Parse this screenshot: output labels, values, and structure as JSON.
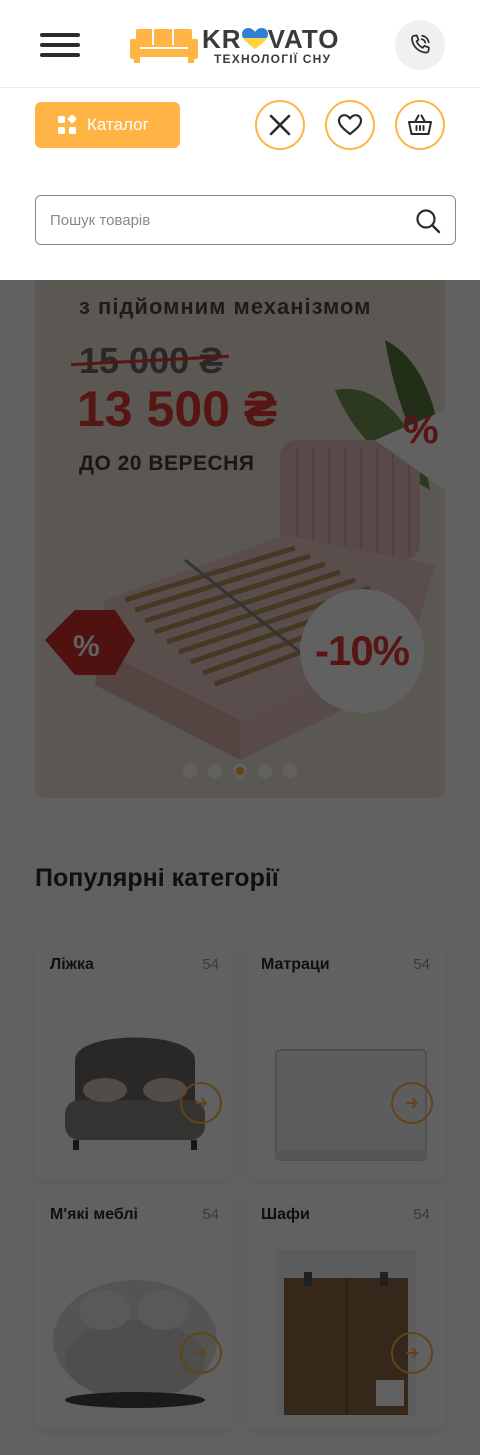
{
  "header": {
    "logo_brand_left": "KR",
    "logo_brand_right": "VATO",
    "logo_tagline": "ТЕХНОЛОГІЇ СНУ"
  },
  "toolbar": {
    "catalog_label": "Каталог"
  },
  "search": {
    "placeholder": "Пошук товарів",
    "value": ""
  },
  "banner": {
    "subtitle": "з підйомним механізмом",
    "old_price": "15 000 ₴",
    "new_price": "13 500 ₴",
    "until": "ДО 20 ВЕРЕСНЯ",
    "percent_mark": "%",
    "discount": "-10%",
    "slides_total": 5,
    "active_slide": 3
  },
  "categories": {
    "title": "Популярні категорії",
    "items": [
      {
        "name": "Ліжка",
        "count": "54"
      },
      {
        "name": "Матраци",
        "count": "54"
      },
      {
        "name": "М'які меблі",
        "count": "54"
      },
      {
        "name": "Шафи",
        "count": "54"
      }
    ]
  },
  "colors": {
    "accent": "#ffb445",
    "sale": "#e53935",
    "logo_heart_top": "#2f7fd6",
    "logo_heart_bottom": "#ffd23f",
    "overlay": "rgba(0,0,0,0.62)"
  },
  "icons": {
    "menu": "hamburger-icon",
    "phone": "phone-icon",
    "catalog": "grid-icon",
    "close": "close-icon",
    "favorites": "heart-icon",
    "cart": "basket-icon",
    "search": "search-icon",
    "card_arrow": "arrow-right-icon"
  }
}
